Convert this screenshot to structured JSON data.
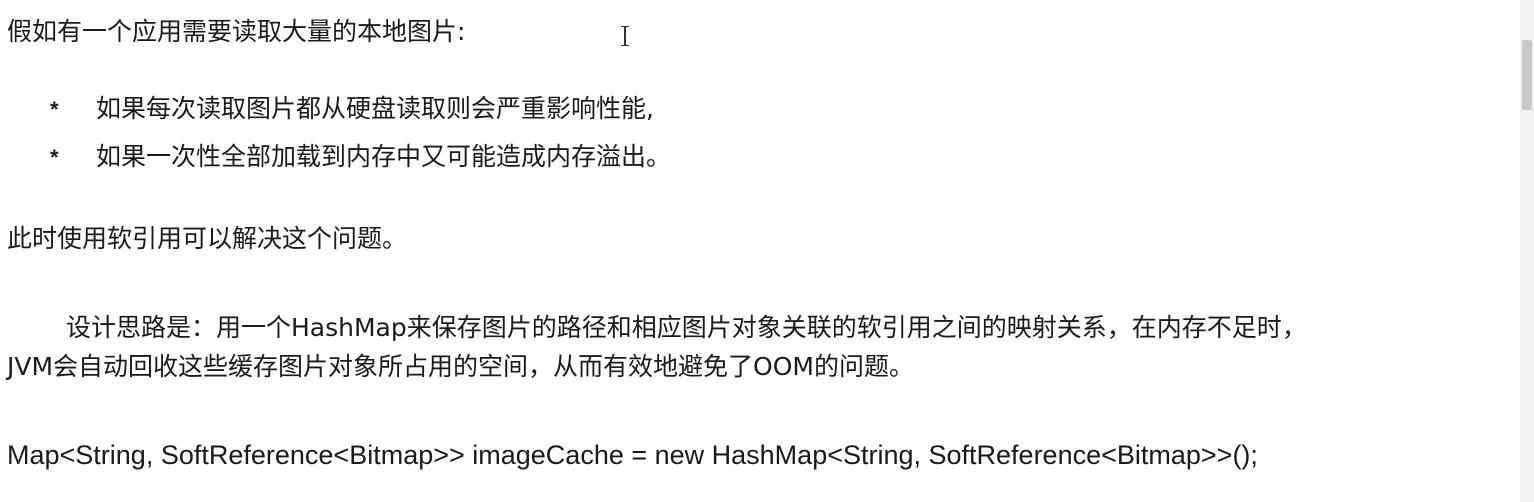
{
  "document": {
    "intro": "假如有一个应用需要读取大量的本地图片:",
    "bullets": [
      {
        "mark": "*",
        "text": "如果每次读取图片都从硬盘读取则会严重影响性能,"
      },
      {
        "mark": "*",
        "text": "如果一次性全部加载到内存中又可能造成内存溢出。"
      }
    ],
    "solution": "此时使用软引用可以解决这个问题。",
    "design_line_1": "设计思路是：用一个HashMap来保存图片的路径和相应图片对象关联的软引用之间的映射关系，在内存不足时，",
    "design_line_2": "JVM会自动回收这些缓存图片对象所占用的空间，从而有效地避免了OOM的问题。",
    "code": "Map<String, SoftReference<Bitmap>> imageCache = new HashMap<String, SoftReference<Bitmap>>();"
  },
  "icons": {
    "cursor": "text-cursor-icon"
  }
}
